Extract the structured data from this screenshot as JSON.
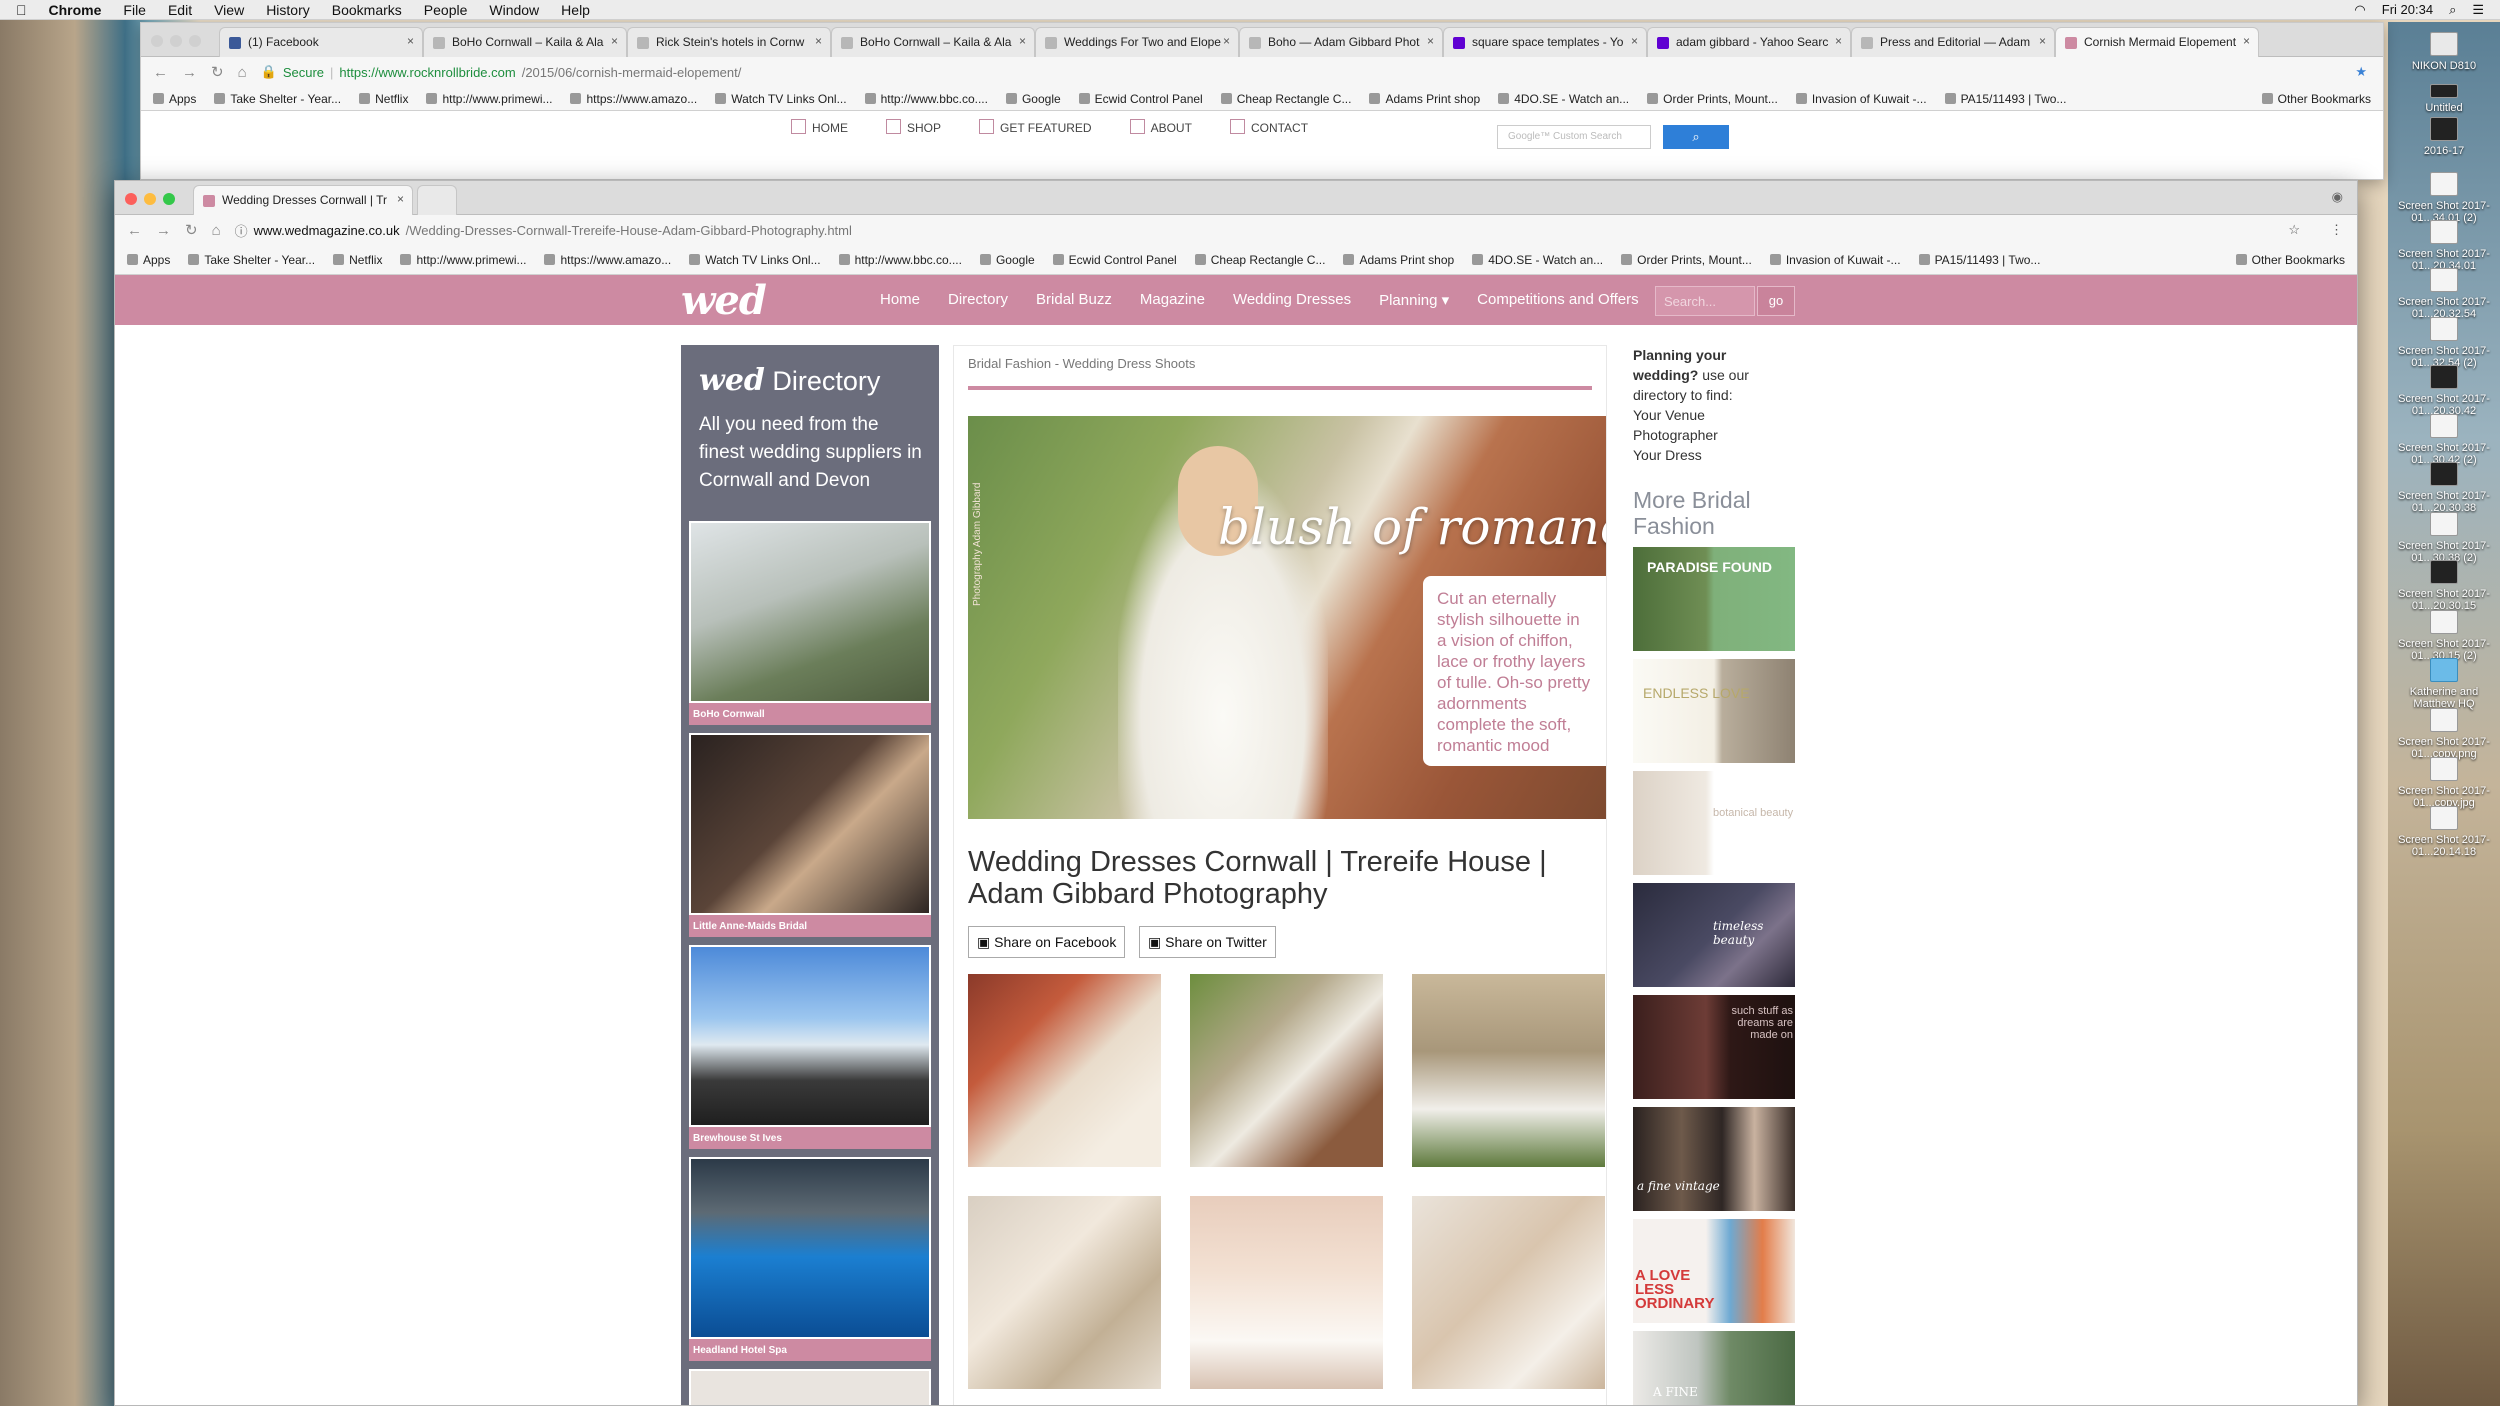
{
  "menubar": {
    "apple": "",
    "app": "Chrome",
    "items": [
      "File",
      "Edit",
      "View",
      "History",
      "Bookmarks",
      "People",
      "Window",
      "Help"
    ],
    "clock": "Fri 20:34"
  },
  "back_window": {
    "tabs": [
      "(1) Facebook",
      "BoHo Cornwall – Kaila & Ala",
      "Rick Stein's hotels in Cornw",
      "BoHo Cornwall – Kaila & Ala",
      "Weddings For Two and Elope",
      "Boho — Adam Gibbard Phot",
      "square space templates - Yo",
      "adam gibbard - Yahoo Searc",
      "Press and Editorial — Adam",
      "Cornish Mermaid Elopement"
    ],
    "secure": "Secure",
    "url_prefix": "https://www.rocknrollbride.com",
    "url_path": "/2015/06/cornish-mermaid-elopement/",
    "bookmarks": [
      "Apps",
      "Take Shelter - Year...",
      "Netflix",
      "http://www.primewi...",
      "https://www.amazo...",
      "Watch TV Links Onl...",
      "http://www.bbc.co....",
      "Google",
      "Ecwid Control Panel",
      "Cheap Rectangle C...",
      "Adams Print shop",
      "4DO.SE - Watch an...",
      "Order Prints, Mount...",
      "Invasion of Kuwait -...",
      "PA15/11493 | Two..."
    ],
    "other_bookmarks": "Other Bookmarks",
    "site_nav": [
      "HOME",
      "SHOP",
      "GET FEATURED",
      "ABOUT",
      "CONTACT"
    ],
    "search_placeholder": "Google™ Custom Search"
  },
  "front_window": {
    "tab": "Wedding Dresses Cornwall | Tr",
    "url_prefix": "www.wedmagazine.co.uk",
    "url_path": "/Wedding-Dresses-Cornwall-Trereife-House-Adam-Gibbard-Photography.html",
    "bookmarks": [
      "Apps",
      "Take Shelter - Year...",
      "Netflix",
      "http://www.primewi...",
      "https://www.amazo...",
      "Watch TV Links Onl...",
      "http://www.bbc.co....",
      "Google",
      "Ecwid Control Panel",
      "Cheap Rectangle C...",
      "Adams Print shop",
      "4DO.SE - Watch an...",
      "Order Prints, Mount...",
      "Invasion of Kuwait -...",
      "PA15/11493 | Two..."
    ],
    "other_bookmarks": "Other Bookmarks"
  },
  "site": {
    "logo": "wed",
    "nav": [
      "Home",
      "Directory",
      "Bridal Buzz",
      "Magazine",
      "Wedding Dresses",
      "Planning ▾",
      "Competitions and Offers"
    ],
    "search_placeholder": "Search...",
    "search_button": "go",
    "accent": "#cd8aa2"
  },
  "directory": {
    "logo": "wed",
    "title": "Directory",
    "subtitle": "All you need from the finest wedding suppliers in Cornwall and Devon",
    "cards": [
      "BoHo Cornwall",
      "Little Anne-Maids Bridal",
      "Brewhouse St Ives",
      "Headland Hotel Spa"
    ]
  },
  "article": {
    "breadcrumb": "Bridal Fashion - Wedding Dress Shoots",
    "hero_credit": "Photography Adam Gibbard",
    "hero_script": "blush of romance",
    "hero_caption": "Cut an eternally stylish silhouette in a vision of chiffon, lace or frothy layers of tulle. Oh-so pretty adornments complete the soft, romantic mood",
    "title": "Wedding Dresses Cornwall | Trereife House | Adam Gibbard Photography",
    "share_facebook": "Share on Facebook",
    "share_twitter": "Share on Twitter"
  },
  "right": {
    "q": "Planning your wedding?",
    "q_rest": " use our directory to find:",
    "links": [
      "Your Venue",
      "Photographer",
      "Your Dress"
    ],
    "more_title": "More Bridal Fashion",
    "thumbs": [
      "PARADISE FOUND",
      "ENDLESS LOVE",
      "botanical beauty",
      "timeless beauty",
      "such stuff as dreams are made on",
      "a fine vintage",
      "A LOVE LESS ORDINARY",
      "A FINE"
    ]
  },
  "desktop": {
    "icons": [
      "NIKON D810",
      "Untitled",
      "2016-17",
      "Screen Shot 2017-01...34.01 (2)",
      "Screen Shot 2017-01...20.34.01",
      "Screen Shot 2017-01...20.32.54",
      "Screen Shot 2017-01...32.54 (2)",
      "Screen Shot 2017-01...20.30.42",
      "Screen Shot 2017-01...30.42 (2)",
      "Screen Shot 2017-01...20.30.38",
      "Screen Shot 2017-01...30.38 (2)",
      "Screen Shot 2017-01...20.30.15",
      "Screen Shot 2017-01...30.15 (2)",
      "Katherine and Matthew HQ",
      "Screen Shot 2017-01...copy.png",
      "Screen Shot 2017-01...copy.jpg",
      "Screen Shot 2017-01...20.14.18"
    ]
  }
}
